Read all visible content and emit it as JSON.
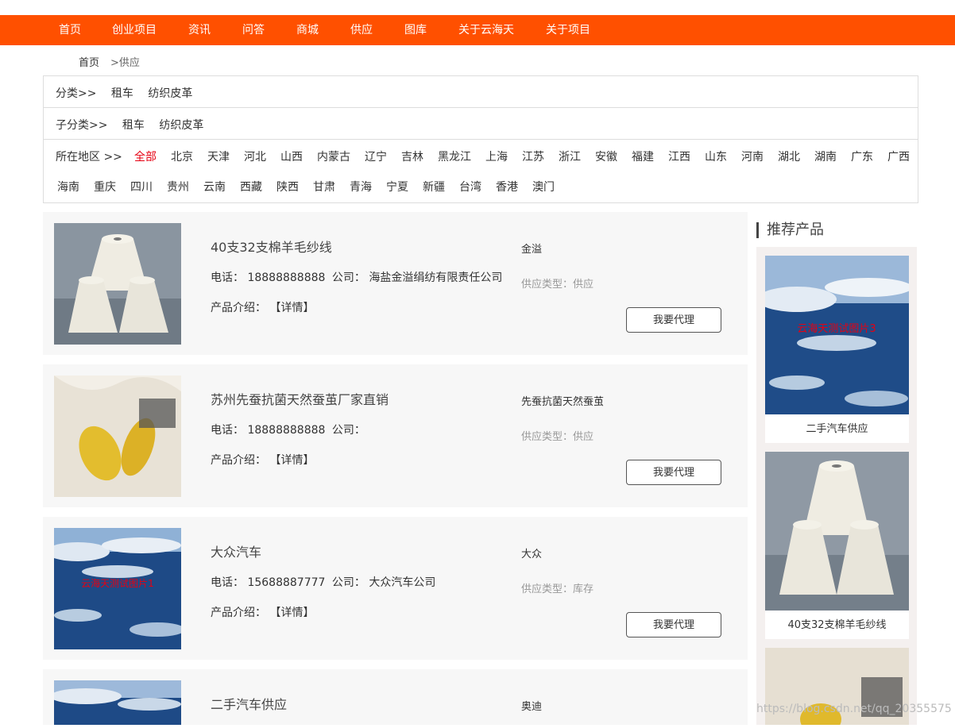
{
  "nav": [
    "首页",
    "创业项目",
    "资讯",
    "问答",
    "商城",
    "供应",
    "图库",
    "关于云海天",
    "关于项目"
  ],
  "breadcrumb": {
    "home": "首页",
    "current": ">供应"
  },
  "filters": {
    "category_label": "分类>>",
    "category_items": [
      "租车",
      "纺织皮革"
    ],
    "subcategory_label": "子分类>>",
    "subcategory_items": [
      "租车",
      "纺织皮革"
    ],
    "region_label": "所在地区 >>",
    "regions_row1": [
      "全部",
      "北京",
      "天津",
      "河北",
      "山西",
      "内蒙古",
      "辽宁",
      "吉林",
      "黑龙江",
      "上海",
      "江苏",
      "浙江",
      "安徽",
      "福建",
      "江西",
      "山东",
      "河南",
      "湖北",
      "湖南",
      "广东",
      "广西"
    ],
    "regions_row2": [
      "海南",
      "重庆",
      "四川",
      "贵州",
      "云南",
      "西藏",
      "陕西",
      "甘肃",
      "青海",
      "宁夏",
      "新疆",
      "台湾",
      "香港",
      "澳门"
    ]
  },
  "products": [
    {
      "title": "40支32支棉羊毛纱线",
      "phone_label": "电话：",
      "phone": "18888888888",
      "company_label": "公司：",
      "company": "海盐金溢绢纺有限责任公司",
      "intro_label": "产品介绍：",
      "detail": "【详情】",
      "brand": "金溢",
      "type": "供应类型：供应",
      "button": "我要代理"
    },
    {
      "title": "苏州先蚕抗菌天然蚕茧厂家直销",
      "phone_label": "电话：",
      "phone": "18888888888",
      "company_label": "公司：",
      "company": "",
      "intro_label": "产品介绍：",
      "detail": "【详情】",
      "brand": "先蚕抗菌天然蚕茧",
      "type": "供应类型：供应",
      "button": "我要代理"
    },
    {
      "title": "大众汽车",
      "phone_label": "电话：",
      "phone": "15688887777",
      "company_label": "公司：",
      "company": "大众汽车公司",
      "intro_label": "产品介绍：",
      "detail": "【详情】",
      "brand": "大众",
      "type": "供应类型：库存",
      "button": "我要代理"
    },
    {
      "title": "二手汽车供应",
      "brand": "奥迪"
    }
  ],
  "image_caption_text": "云海天测试图片1",
  "sidebar": {
    "title": "推荐产品",
    "items": [
      {
        "caption": "二手汽车供应",
        "overlay": "云海天测试图片3"
      },
      {
        "caption": "40支32支棉羊毛纱线"
      }
    ]
  },
  "watermark": "https://blog.csdn.net/qq_20355575",
  "colors": {
    "nav_bg": "#ff5000",
    "active_region": "#e60012"
  }
}
